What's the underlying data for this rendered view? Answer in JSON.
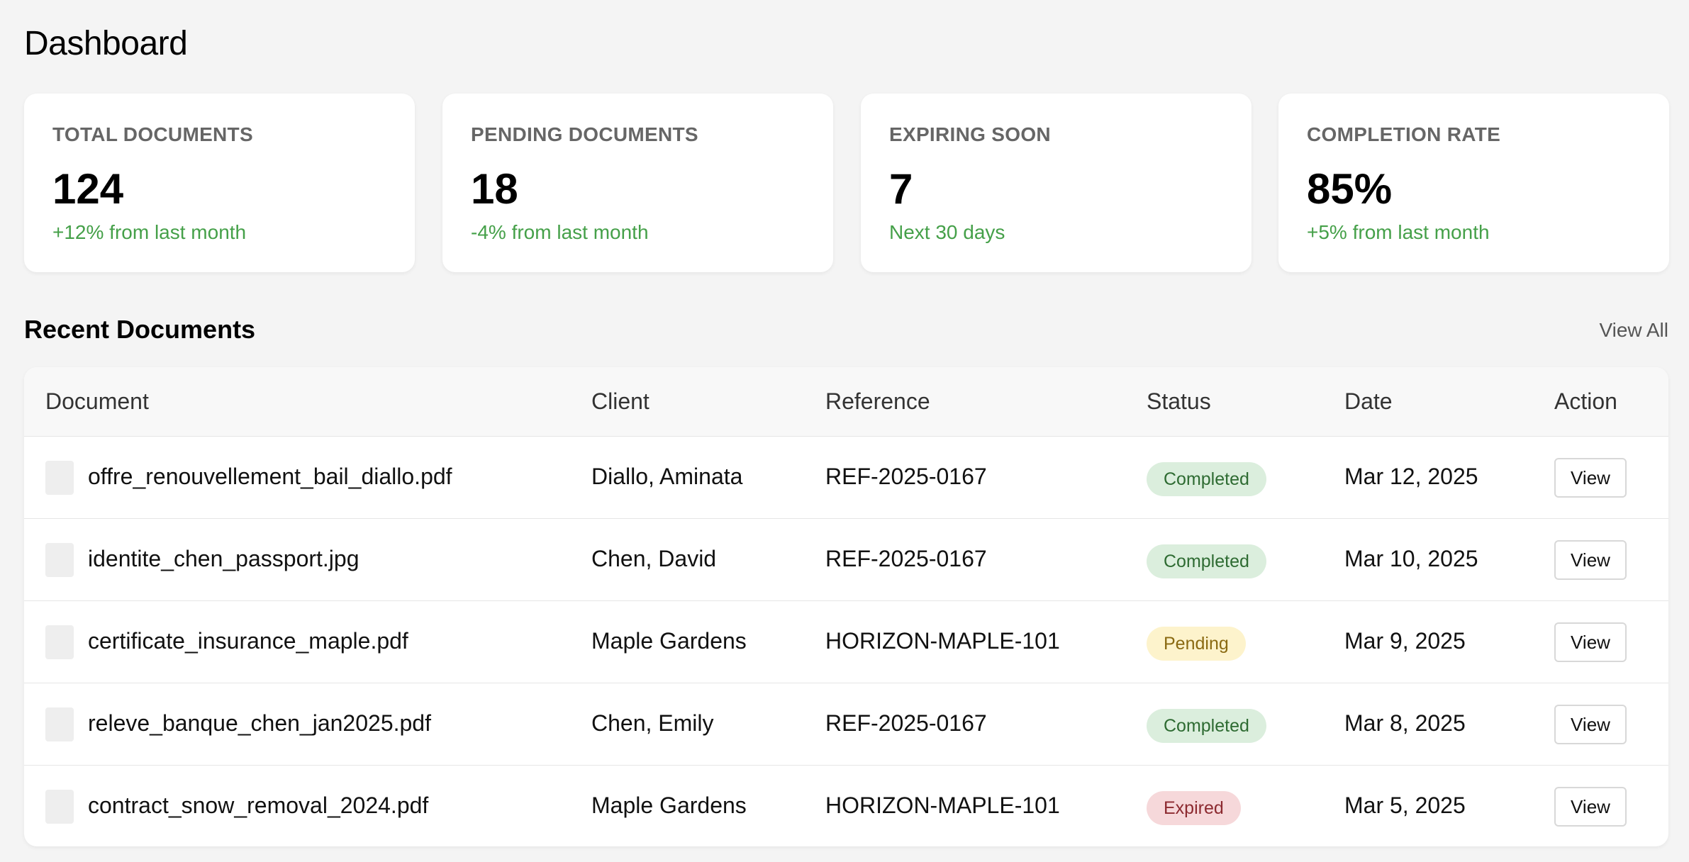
{
  "page": {
    "title": "Dashboard"
  },
  "stats": [
    {
      "label": "TOTAL DOCUMENTS",
      "value": "124",
      "sub": "+12% from last month"
    },
    {
      "label": "PENDING DOCUMENTS",
      "value": "18",
      "sub": "-4% from last month"
    },
    {
      "label": "EXPIRING SOON",
      "value": "7",
      "sub": "Next 30 days"
    },
    {
      "label": "COMPLETION RATE",
      "value": "85%",
      "sub": "+5% from last month"
    }
  ],
  "colors": {
    "stat_sub": "#45a049",
    "completed_bg": "#dbeedd",
    "pending_bg": "#fdf3cc",
    "expired_bg": "#f6d8da"
  },
  "recent": {
    "title": "Recent Documents",
    "view_all": "View All",
    "columns": [
      "Document",
      "Client",
      "Reference",
      "Status",
      "Date",
      "Action"
    ],
    "rows": [
      {
        "icon": "file-icon",
        "document": "offre_renouvellement_bail_diallo.pdf",
        "client": "Diallo, Aminata",
        "reference": "REF-2025-0167",
        "status": "Completed",
        "date": "Mar 12, 2025",
        "action": "View"
      },
      {
        "icon": "file-icon",
        "document": "identite_chen_passport.jpg",
        "client": "Chen, David",
        "reference": "REF-2025-0167",
        "status": "Completed",
        "date": "Mar 10, 2025",
        "action": "View"
      },
      {
        "icon": "file-icon",
        "document": "certificate_insurance_maple.pdf",
        "client": "Maple Gardens",
        "reference": "HORIZON-MAPLE-101",
        "status": "Pending",
        "date": "Mar 9, 2025",
        "action": "View"
      },
      {
        "icon": "file-icon",
        "document": "releve_banque_chen_jan2025.pdf",
        "client": "Chen, Emily",
        "reference": "REF-2025-0167",
        "status": "Completed",
        "date": "Mar 8, 2025",
        "action": "View"
      },
      {
        "icon": "file-icon",
        "document": "contract_snow_removal_2024.pdf",
        "client": "Maple Gardens",
        "reference": "HORIZON-MAPLE-101",
        "status": "Expired",
        "date": "Mar 5, 2025",
        "action": "View"
      }
    ]
  }
}
